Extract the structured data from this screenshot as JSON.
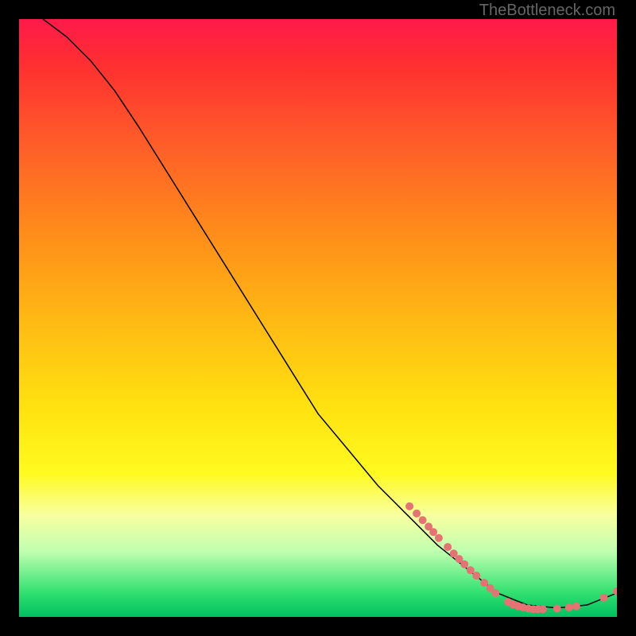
{
  "watermark": "TheBottleneck.com",
  "chart_data": {
    "type": "line",
    "title": "",
    "xlabel": "",
    "ylabel": "",
    "xlim": [
      0,
      100
    ],
    "ylim": [
      0,
      100
    ],
    "series": [
      {
        "name": "curve",
        "x": [
          4,
          8,
          12,
          16,
          20,
          25,
          30,
          35,
          40,
          45,
          50,
          55,
          60,
          65,
          70,
          75,
          80,
          85,
          90,
          95,
          100
        ],
        "y": [
          100,
          97,
          93,
          88,
          82,
          74,
          66,
          58,
          50,
          42,
          34,
          28,
          22,
          17,
          12,
          8,
          4,
          2,
          1.5,
          2,
          4
        ]
      }
    ],
    "markers": [
      {
        "x": 65.3,
        "y": 18.5
      },
      {
        "x": 66.5,
        "y": 17.3
      },
      {
        "x": 67.5,
        "y": 16.2
      },
      {
        "x": 68.5,
        "y": 15.1
      },
      {
        "x": 69.3,
        "y": 14.2
      },
      {
        "x": 70.2,
        "y": 13.2
      },
      {
        "x": 71.7,
        "y": 11.7
      },
      {
        "x": 72.7,
        "y": 10.6
      },
      {
        "x": 73.6,
        "y": 9.7
      },
      {
        "x": 74.5,
        "y": 8.8
      },
      {
        "x": 75.5,
        "y": 7.8
      },
      {
        "x": 76.5,
        "y": 6.9
      },
      {
        "x": 77.8,
        "y": 5.7
      },
      {
        "x": 78.8,
        "y": 4.8
      },
      {
        "x": 79.7,
        "y": 4.0
      },
      {
        "x": 81.8,
        "y": 2.5
      },
      {
        "x": 82.6,
        "y": 2.1
      },
      {
        "x": 83.5,
        "y": 1.8
      },
      {
        "x": 84.3,
        "y": 1.6
      },
      {
        "x": 85.2,
        "y": 1.4
      },
      {
        "x": 86.0,
        "y": 1.3
      },
      {
        "x": 86.8,
        "y": 1.3
      },
      {
        "x": 87.6,
        "y": 1.3
      },
      {
        "x": 90.0,
        "y": 1.4
      },
      {
        "x": 92.0,
        "y": 1.6
      },
      {
        "x": 93.2,
        "y": 1.8
      },
      {
        "x": 97.8,
        "y": 3.2
      },
      {
        "x": 100.0,
        "y": 4.3
      }
    ],
    "colors": {
      "curve": "#000000",
      "marker_fill": "#e57373",
      "marker_stroke": "#e57373"
    }
  }
}
